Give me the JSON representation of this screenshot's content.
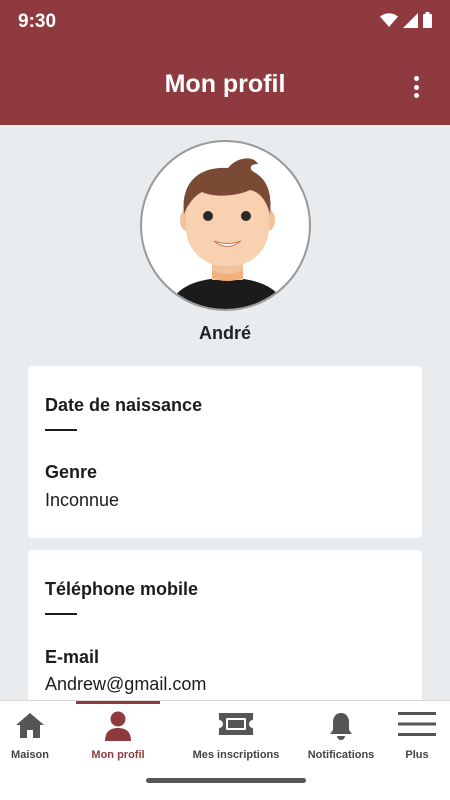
{
  "status_bar": {
    "time": "9:30"
  },
  "header": {
    "title": "Mon profil"
  },
  "profile": {
    "name": "André"
  },
  "card_personal": {
    "birth_label": "Date de naissance",
    "birth_value": "—",
    "gender_label": "Genre",
    "gender_value": "Inconnue"
  },
  "card_contact": {
    "phone_label": "Téléphone mobile",
    "phone_value": "—",
    "email_label": "E-mail",
    "email_value": "Andrew@gmail.com"
  },
  "bottom_nav": {
    "items": [
      {
        "label": "Maison",
        "icon": "home-icon"
      },
      {
        "label": "Mon profil",
        "icon": "person-icon",
        "active": true
      },
      {
        "label": "Mes inscriptions",
        "icon": "ticket-icon"
      },
      {
        "label": "Notifications",
        "icon": "bell-icon"
      },
      {
        "label": "Plus",
        "icon": "menu-icon"
      }
    ]
  },
  "colors": {
    "accent": "#8e3a3f",
    "background": "#e9ecee"
  }
}
